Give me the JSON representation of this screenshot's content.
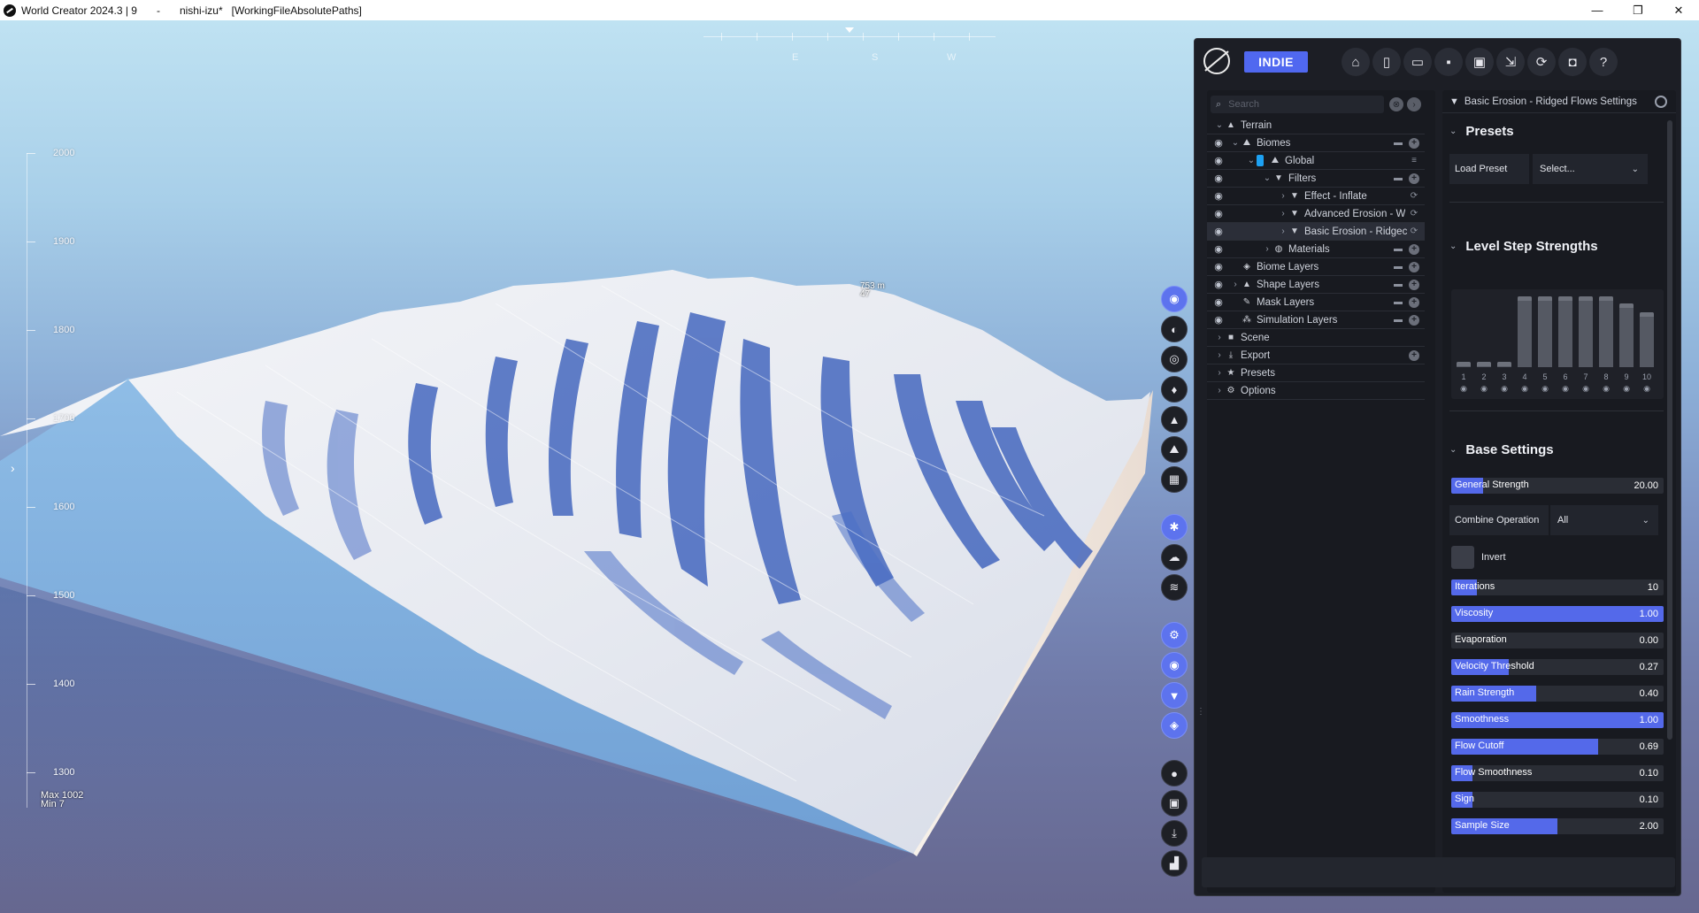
{
  "titlebar": {
    "app": "World Creator 2024.3 | 9",
    "sep": "-",
    "file": "nishi-izu*",
    "mode": "[WorkingFileAbsolutePaths]",
    "minimize": "—",
    "maximize": "❐",
    "close": "✕"
  },
  "viewport": {
    "compass": [
      "E",
      "S",
      "W"
    ],
    "altitude_labels": [
      "2000",
      "1900",
      "1800",
      "1700",
      "1600",
      "1500",
      "1400",
      "1300"
    ],
    "max_label": "Max 1002",
    "min_label": "Min 7",
    "peak_label": "753 m",
    "peak_sub": "47",
    "side_arrow": "›"
  },
  "toolstrip": [
    {
      "name": "view-icon",
      "glyph": "◉",
      "accent": true
    },
    {
      "name": "globe-icon",
      "glyph": "◐",
      "accent": false
    },
    {
      "name": "target-icon",
      "glyph": "◎",
      "accent": false
    },
    {
      "name": "flame-icon",
      "glyph": "♦",
      "accent": false
    },
    {
      "name": "mountain-icon",
      "glyph": "▲",
      "accent": false
    },
    {
      "name": "landscape-icon",
      "glyph": "⛰",
      "accent": false
    },
    {
      "name": "grid-icon",
      "glyph": "▦",
      "accent": false
    },
    {
      "name": "sun-icon",
      "glyph": "✱",
      "accent": true
    },
    {
      "name": "cloud-icon",
      "glyph": "☁",
      "accent": false
    },
    {
      "name": "water-icon",
      "glyph": "≋",
      "accent": false
    },
    {
      "name": "settings-icon",
      "glyph": "⚙",
      "accent": true
    },
    {
      "name": "eye-icon",
      "glyph": "◉",
      "accent": true
    },
    {
      "name": "filter-icon",
      "glyph": "▼",
      "accent": true
    },
    {
      "name": "layers-icon",
      "glyph": "◈",
      "accent": true
    },
    {
      "name": "record-icon",
      "glyph": "●",
      "accent": false
    },
    {
      "name": "image-icon",
      "glyph": "▣",
      "accent": false
    },
    {
      "name": "download-icon",
      "glyph": "⤓",
      "accent": false
    },
    {
      "name": "chart-icon",
      "glyph": "▟",
      "accent": false
    }
  ],
  "toolbar": {
    "edition": "INDIE",
    "icons": [
      {
        "name": "home-icon",
        "glyph": "⌂"
      },
      {
        "name": "new-file-icon",
        "glyph": "▯"
      },
      {
        "name": "open-folder-icon",
        "glyph": "▭"
      },
      {
        "name": "save-icon",
        "glyph": "▪"
      },
      {
        "name": "save-as-icon",
        "glyph": "▣"
      },
      {
        "name": "export-icon",
        "glyph": "⇲"
      },
      {
        "name": "sync-icon",
        "glyph": "⟳"
      },
      {
        "name": "camera-icon",
        "glyph": "◘"
      },
      {
        "name": "help-icon",
        "glyph": "?"
      }
    ]
  },
  "tree": {
    "search_placeholder": "Search",
    "search_icon": "⌕",
    "clear_icon": "⊗",
    "expand_icon": "›",
    "items": [
      {
        "label": "Terrain",
        "indent": 0,
        "chev": "⌄",
        "icon": "▲",
        "eye": false,
        "actions": []
      },
      {
        "label": "Biomes",
        "indent": 1,
        "chev": "⌄",
        "icon": "⛰",
        "eye": true,
        "actions": [
          "folder",
          "plus"
        ]
      },
      {
        "label": "Global",
        "indent": 2,
        "chev": "⌄",
        "icon": "⛰",
        "eye": true,
        "swatch": true,
        "actions": [
          "stack"
        ]
      },
      {
        "label": "Filters",
        "indent": 3,
        "chev": "⌄",
        "icon": "▼",
        "eye": true,
        "actions": [
          "folder",
          "plus"
        ]
      },
      {
        "label": "Effect - Inflate",
        "indent": 4,
        "chev": "›",
        "icon": "▼",
        "eye": true,
        "actions": [
          "sync"
        ]
      },
      {
        "label": "Advanced Erosion - W",
        "indent": 4,
        "chev": "›",
        "icon": "▼",
        "eye": true,
        "actions": [
          "sync"
        ]
      },
      {
        "label": "Basic Erosion - Ridgec",
        "indent": 4,
        "chev": "›",
        "icon": "▼",
        "eye": true,
        "selected": true,
        "actions": [
          "sync"
        ]
      },
      {
        "label": "Materials",
        "indent": 3,
        "chev": "›",
        "icon": "◍",
        "eye": true,
        "actions": [
          "folder",
          "plus"
        ]
      },
      {
        "label": "Biome Layers",
        "indent": 1,
        "chev": "",
        "icon": "◈",
        "eye": true,
        "actions": [
          "folder",
          "plus"
        ]
      },
      {
        "label": "Shape Layers",
        "indent": 1,
        "chev": "›",
        "icon": "▲",
        "eye": true,
        "actions": [
          "folder",
          "plus"
        ]
      },
      {
        "label": "Mask Layers",
        "indent": 1,
        "chev": "",
        "icon": "✎",
        "eye": true,
        "actions": [
          "folder",
          "plus"
        ]
      },
      {
        "label": "Simulation Layers",
        "indent": 1,
        "chev": "",
        "icon": "⁂",
        "eye": true,
        "actions": [
          "folder",
          "plus"
        ]
      },
      {
        "label": "Scene",
        "indent": 0,
        "chev": "›",
        "icon": "■",
        "eye": false,
        "actions": []
      },
      {
        "label": "Export",
        "indent": 0,
        "chev": "›",
        "icon": "⤓",
        "eye": false,
        "actions": [
          "plus"
        ]
      },
      {
        "label": "Presets",
        "indent": 0,
        "chev": "›",
        "icon": "★",
        "eye": false,
        "actions": []
      },
      {
        "label": "Options",
        "indent": 0,
        "chev": "›",
        "icon": "⚙",
        "eye": false,
        "actions": []
      }
    ]
  },
  "settings": {
    "header": "Basic Erosion - Ridged Flows Settings",
    "presets": {
      "title": "Presets",
      "load_label": "Load Preset",
      "select_value": "Select..."
    },
    "level_steps": {
      "title": "Level Step Strengths",
      "levels": [
        "1",
        "2",
        "3",
        "4",
        "5",
        "6",
        "7",
        "8",
        "9",
        "10"
      ],
      "values": [
        0.08,
        0.08,
        0.08,
        1.0,
        1.0,
        1.0,
        1.0,
        1.0,
        0.9,
        0.78
      ]
    },
    "base": {
      "title": "Base Settings",
      "general_strength": {
        "label": "General Strength",
        "value": "20.00",
        "fill": 0.15
      },
      "combine_label": "Combine Operation",
      "combine_value": "All",
      "invert_label": "Invert",
      "sliders": [
        {
          "label": "Iterations",
          "value": "10",
          "fill": 0.12
        },
        {
          "label": "Viscosity",
          "value": "1.00",
          "fill": 1.0
        },
        {
          "label": "Evaporation",
          "value": "0.00",
          "fill": 0.0
        },
        {
          "label": "Velocity Threshold",
          "value": "0.27",
          "fill": 0.27
        },
        {
          "label": "Rain Strength",
          "value": "0.40",
          "fill": 0.4
        },
        {
          "label": "Smoothness",
          "value": "1.00",
          "fill": 1.0
        },
        {
          "label": "Flow Cutoff",
          "value": "0.69",
          "fill": 0.69
        },
        {
          "label": "Flow Smoothness",
          "value": "0.10",
          "fill": 0.1
        },
        {
          "label": "Sign",
          "value": "0.10",
          "fill": 0.1
        },
        {
          "label": "Sample Size",
          "value": "2.00",
          "fill": 0.5
        }
      ]
    }
  }
}
